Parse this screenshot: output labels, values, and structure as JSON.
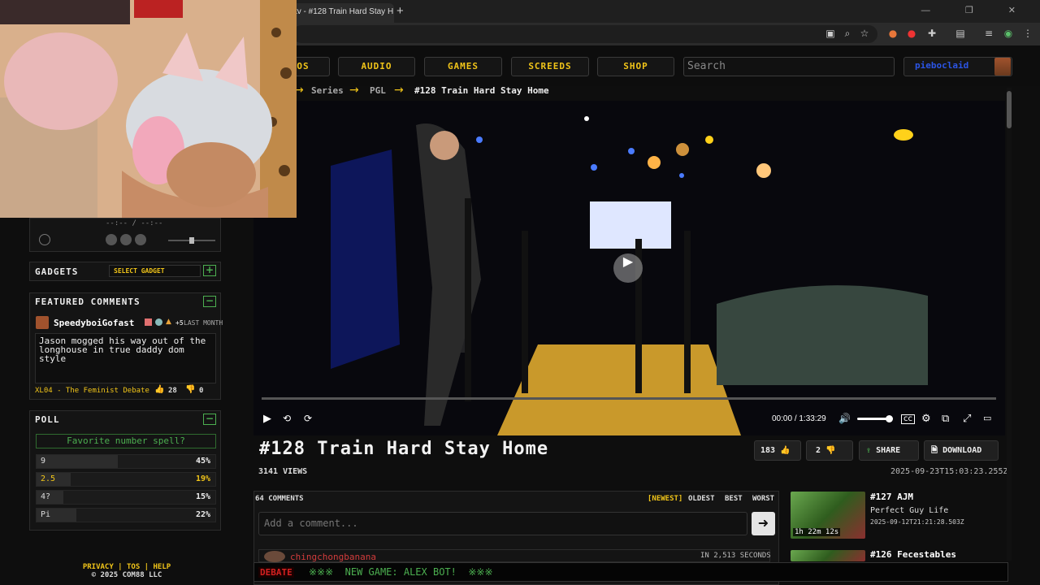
{
  "browser": {
    "tab_title": "tv - #128 Train Hard Stay H",
    "close_tab": "×",
    "new_tab": "+",
    "window_controls": "— ❐ ✕"
  },
  "nav": {
    "items": [
      {
        "label": "OS"
      },
      {
        "label": "AUDIO"
      },
      {
        "label": "GAMES"
      },
      {
        "label": "SCREEDS"
      },
      {
        "label": "SHOP"
      }
    ],
    "search_placeholder": "Search",
    "username": "pieboclaid"
  },
  "breadcrumb": {
    "items": [
      "Series",
      "PGL",
      "#128 Train Hard Stay Home"
    ],
    "arrow": "→"
  },
  "sidebar": {
    "player_time": "--:-- / --:--",
    "gadgets": {
      "title": "GADGETS",
      "select_label": "SELECT GADGET",
      "add": "+"
    },
    "featured": {
      "title": "FEATURED COMMENTS",
      "collapse": "−",
      "author": "SpeedyboiGofast",
      "author_badges": "+5",
      "time": "LAST MONTH",
      "text": "Jason mogged his way out of the longhouse in true daddy dom style",
      "video_link": "XL04 - The Feminist Debate",
      "likes": "28",
      "dislikes": "0"
    },
    "poll": {
      "title": "POLL",
      "collapse": "−",
      "question": "Favorite number spell?",
      "options": [
        {
          "label": "9",
          "pct": "45%",
          "value": 0.45,
          "highlight": false
        },
        {
          "label": "2.5",
          "pct": "19%",
          "value": 0.19,
          "highlight": true
        },
        {
          "label": "4?",
          "pct": "15%",
          "value": 0.15,
          "highlight": false
        },
        {
          "label": "Pi",
          "pct": "22%",
          "value": 0.22,
          "highlight": false
        }
      ]
    },
    "footer": {
      "links": "PRIVACY | TOS | HELP",
      "copyright": "© 2025 COM88 LLC"
    }
  },
  "player": {
    "current_time": "00:00",
    "separator": "/",
    "duration": "1:33:29",
    "progress": 0.0
  },
  "video": {
    "title": "#128 Train Hard Stay Home",
    "views": "3141 VIEWS",
    "date": "2025-09-23T15:03:23.255Z",
    "likes": "183",
    "dislikes": "2",
    "share_label": "SHARE",
    "download_label": "DOWNLOAD"
  },
  "comments": {
    "count_label": "64 COMMENTS",
    "sorts": [
      "[NEWEST]",
      "OLDEST",
      "BEST",
      "WORST"
    ],
    "input_placeholder": "Add a comment...",
    "send": "➜",
    "first": {
      "author": "chingchongbanana",
      "time": "IN 2,513 SECONDS"
    }
  },
  "related": [
    {
      "title": "#127 AJM",
      "subtitle": "Perfect Guy Life",
      "date": "2025-09-12T21:21:28.503Z",
      "duration": "1h 22m 12s"
    },
    {
      "title": "#126 Fecestables",
      "subtitle": "",
      "date": "",
      "duration": ""
    }
  ],
  "ticker": {
    "tag": "DEBATE",
    "message": "※※※  NEW GAME: ALEX BOT!  ※※※"
  },
  "colors": {
    "accent": "#f0c419",
    "green": "#4caf50",
    "bg": "#0e0e0e"
  }
}
